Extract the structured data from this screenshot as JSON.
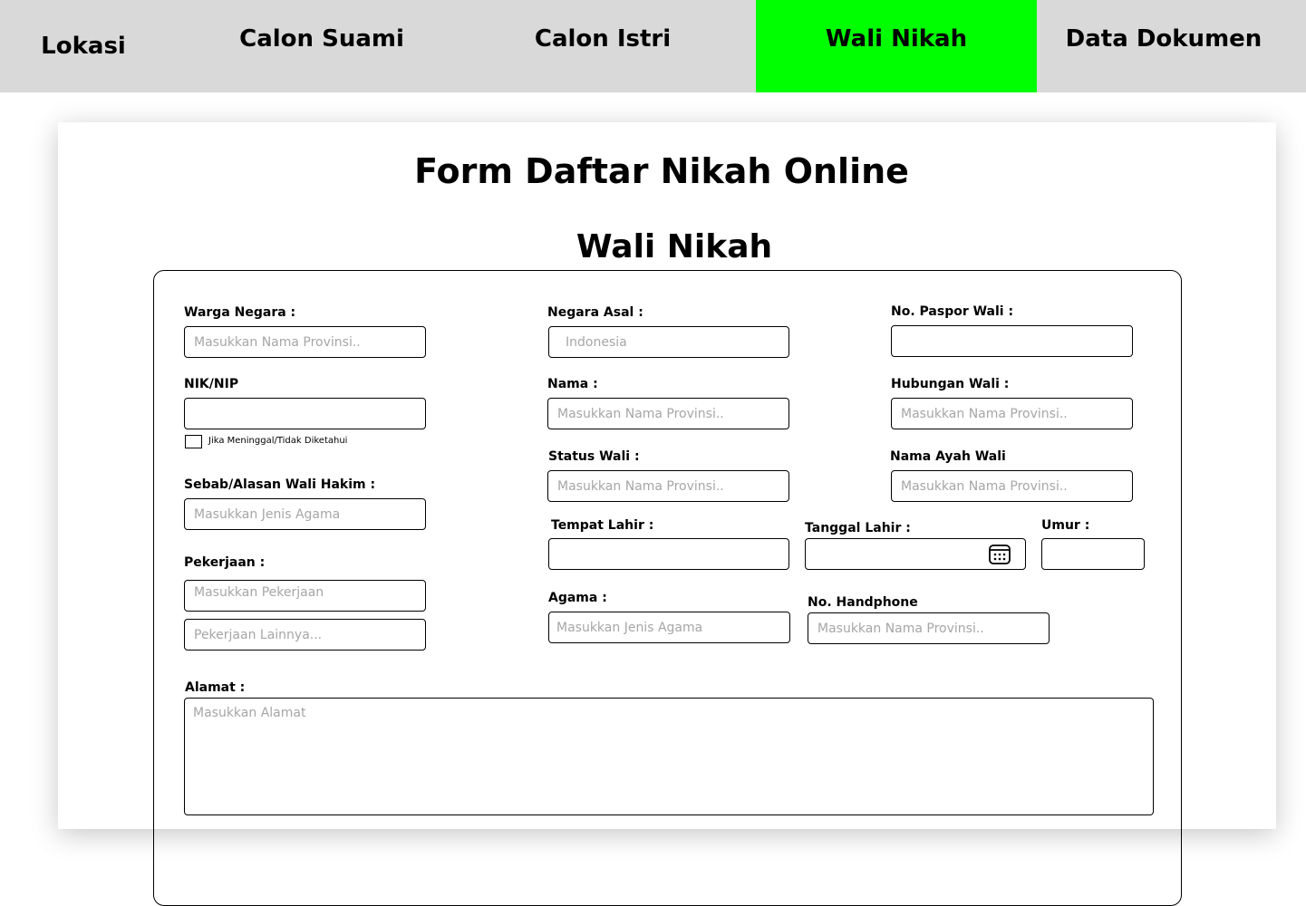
{
  "tabs": [
    {
      "label": "Lokasi"
    },
    {
      "label": "Calon Suami"
    },
    {
      "label": "Calon Istri"
    },
    {
      "label": "Wali Nikah",
      "active": true
    },
    {
      "label": "Data Dokumen"
    }
  ],
  "colors": {
    "active_tab": "#00ff00",
    "tab_bar": "#d9d9d9",
    "placeholder": "#a6a6a6"
  },
  "form": {
    "title": "Form Daftar Nikah Online",
    "section_title": "Wali Nikah",
    "fields": {
      "warga_negara": {
        "label": "Warga Negara :",
        "placeholder": "Masukkan Nama Provinsi.."
      },
      "negara_asal": {
        "label": "Negara Asal :",
        "placeholder": "Indonesia"
      },
      "no_paspor": {
        "label": "No. Paspor Wali :",
        "placeholder": ""
      },
      "nik": {
        "label": "NIK/NIP",
        "placeholder": ""
      },
      "meninggal": {
        "label": "Jika Meninggal/Tidak Diketahui"
      },
      "nama": {
        "label": "Nama :",
        "placeholder": "Masukkan Nama Provinsi.."
      },
      "hubungan": {
        "label": "Hubungan Wali :",
        "placeholder": "Masukkan Nama Provinsi.."
      },
      "status_wali": {
        "label": "Status Wali :",
        "placeholder": "Masukkan Nama Provinsi.."
      },
      "nama_ayah": {
        "label": "Nama Ayah Wali",
        "placeholder": "Masukkan Nama Provinsi.."
      },
      "sebab": {
        "label": "Sebab/Alasan Wali Hakim :",
        "placeholder": "Masukkan Jenis Agama"
      },
      "tempat_lahir": {
        "label": "Tempat Lahir :",
        "placeholder": ""
      },
      "tanggal_lahir": {
        "label": "Tanggal Lahir :",
        "placeholder": "",
        "icon": "calendar-icon"
      },
      "umur": {
        "label": "Umur :",
        "placeholder": ""
      },
      "pekerjaan": {
        "label": "Pekerjaan :",
        "placeholder": "Masukkan Pekerjaan",
        "placeholder_other": "Pekerjaan Lainnya..."
      },
      "agama": {
        "label": "Agama :",
        "placeholder": "Masukkan Jenis Agama"
      },
      "no_hp": {
        "label": "No. Handphone",
        "placeholder": "Masukkan Nama Provinsi.."
      },
      "alamat": {
        "label": "Alamat :",
        "placeholder": "Masukkan Alamat"
      }
    }
  }
}
